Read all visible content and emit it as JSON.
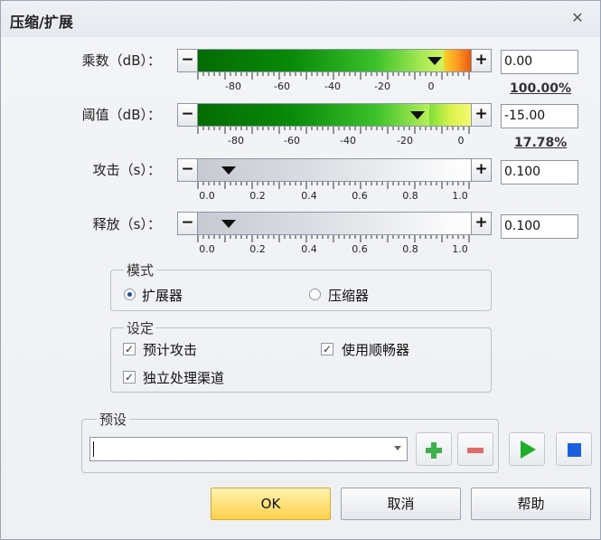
{
  "dialog": {
    "title": "压缩/扩展",
    "close_glyph": "✕"
  },
  "controls": {
    "multiplier": {
      "label": "乘数（dB）：",
      "minus": "−",
      "plus": "+",
      "value": "0.00",
      "percent": "100.00%",
      "ticks": [
        "-80",
        "-60",
        "-40",
        "-20",
        "0"
      ]
    },
    "threshold": {
      "label": "阈值（dB）：",
      "minus": "−",
      "plus": "+",
      "value": "-15.00",
      "percent": "17.78%",
      "ticks": [
        "-80",
        "-60",
        "-40",
        "-20",
        "0"
      ]
    },
    "attack": {
      "label": "攻击（s）：",
      "minus": "−",
      "plus": "+",
      "value": "0.100",
      "ticks": [
        "0.0",
        "0.2",
        "0.4",
        "0.6",
        "0.8",
        "1.0"
      ]
    },
    "release": {
      "label": "释放（s）：",
      "minus": "−",
      "plus": "+",
      "value": "0.100",
      "ticks": [
        "0.0",
        "0.2",
        "0.4",
        "0.6",
        "0.8",
        "1.0"
      ]
    }
  },
  "mode": {
    "title": "模式",
    "options": [
      {
        "label": "扩展器",
        "selected": true
      },
      {
        "label": "压缩器",
        "selected": false
      }
    ]
  },
  "settings": {
    "title": "设定",
    "options": [
      {
        "label": "预计攻击",
        "checked": true
      },
      {
        "label": "使用顺畅器",
        "checked": true
      },
      {
        "label": "独立处理渠道",
        "checked": true
      }
    ]
  },
  "presets": {
    "title": "预设",
    "value": ""
  },
  "buttons": {
    "ok": "OK",
    "cancel": "取消",
    "help": "帮助"
  },
  "icons": {
    "check_glyph": "✓"
  },
  "colors": {
    "accent_ok": "#ffd04a",
    "add": "#3cb24a",
    "remove": "#e36a6a",
    "play": "#1fae2a",
    "stop": "#1a5fe0"
  }
}
